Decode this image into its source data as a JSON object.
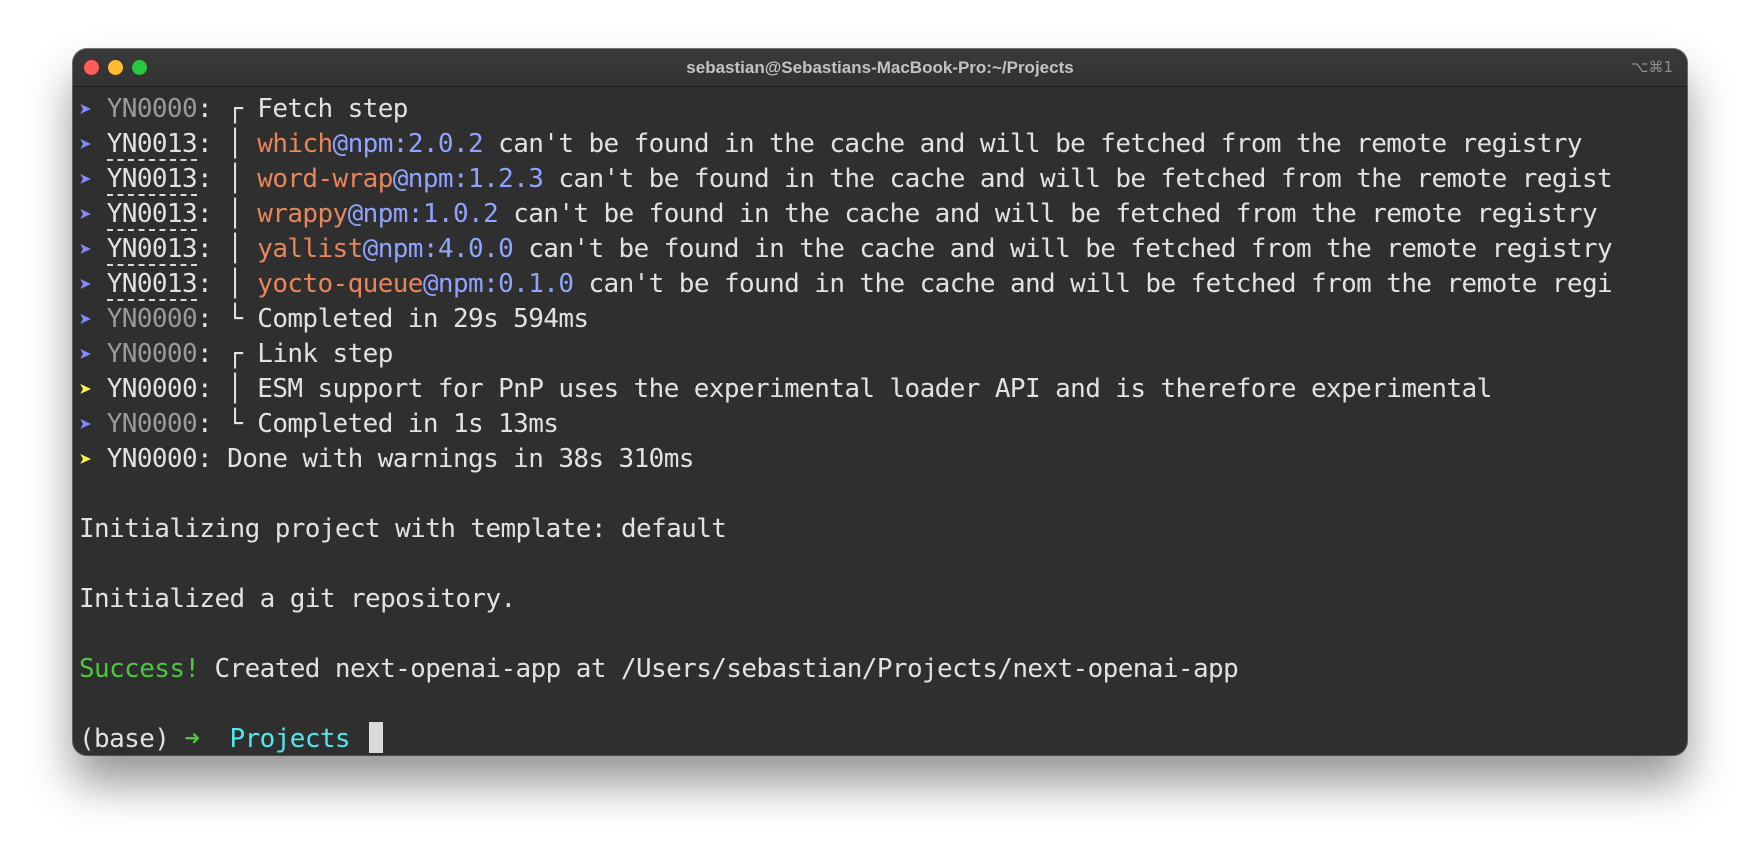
{
  "window": {
    "title": "sebastian@Sebastians-MacBook-Pro:~/Projects",
    "shortcut": "⌥⌘1",
    "buttons": [
      {
        "name": "close",
        "color": "#ff5f57"
      },
      {
        "name": "minimize",
        "color": "#febc2e"
      },
      {
        "name": "zoom",
        "color": "#28c840"
      }
    ]
  },
  "terminal": {
    "arrow_glyph": "➤",
    "lines": [
      {
        "code": "YN0000",
        "sep": ": ┌ ",
        "text": "Fetch step"
      },
      {
        "code": "YN0013",
        "sep": ": │ ",
        "pkg": "which",
        "at": "@npm:2.0.2",
        "text": " can't be found in the cache and will be fetched from the remote registry"
      },
      {
        "code": "YN0013",
        "sep": ": │ ",
        "pkg": "word-wrap",
        "at": "@npm:1.2.3",
        "text": " can't be found in the cache and will be fetched from the remote regist"
      },
      {
        "code": "YN0013",
        "sep": ": │ ",
        "pkg": "wrappy",
        "at": "@npm:1.0.2",
        "text": " can't be found in the cache and will be fetched from the remote registry"
      },
      {
        "code": "YN0013",
        "sep": ": │ ",
        "pkg": "yallist",
        "at": "@npm:4.0.0",
        "text": " can't be found in the cache and will be fetched from the remote registry"
      },
      {
        "code": "YN0013",
        "sep": ": │ ",
        "pkg": "yocto-queue",
        "at": "@npm:0.1.0",
        "text": " can't be found in the cache and will be fetched from the remote regi"
      },
      {
        "code": "YN0000",
        "sep": ": └ ",
        "text": "Completed in 29s 594ms"
      },
      {
        "code": "YN0000",
        "sep": ": ┌ ",
        "text": "Link step"
      },
      {
        "code": "YN0000",
        "sep": ": │ ",
        "text": "ESM support for PnP uses the experimental loader API and is therefore experimental"
      },
      {
        "code": "YN0000",
        "sep": ": └ ",
        "text": "Completed in 1s 13ms"
      },
      {
        "code": "YN0000",
        "sep": ": ",
        "text": "Done with warnings in 38s 310ms"
      }
    ],
    "init_template": "Initializing project with template: default",
    "init_git": "Initialized a git repository.",
    "success_label": "Success!",
    "success_text": " Created next-openai-app at /Users/sebastian/Projects/next-openai-app",
    "prompt_env": "(base) ",
    "prompt_arrow": "➜",
    "prompt_dir": "Projects"
  }
}
